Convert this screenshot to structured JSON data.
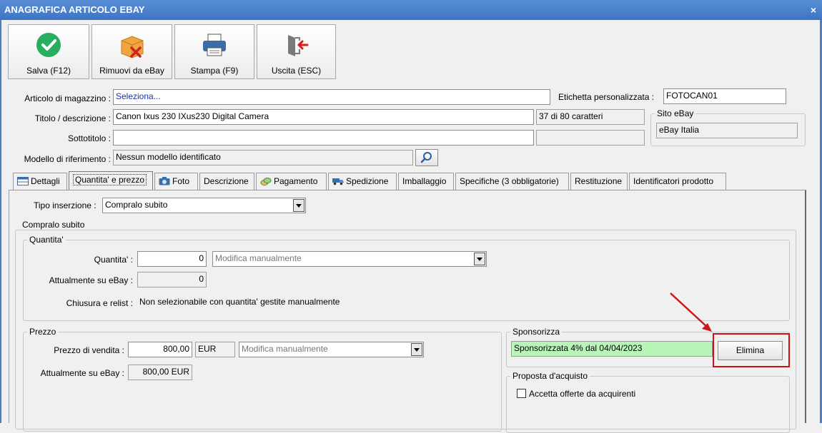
{
  "window": {
    "title": "ANAGRAFICA ARTICOLO EBAY",
    "close": "×"
  },
  "toolbar": {
    "save": "Salva (F12)",
    "remove": "Rimuovi da eBay",
    "print": "Stampa (F9)",
    "exit": "Uscita (ESC)"
  },
  "form": {
    "article_label": "Articolo di magazzino :",
    "article_value": "Seleziona...",
    "custom_label_label": "Etichetta personalizzata :",
    "custom_label_value": "FOTOCAN01",
    "title_label": "Titolo / descrizione :",
    "title_value": "Canon Ixus 230 IXus230 Digital Camera",
    "title_count": "37 di 80 caratteri",
    "subtitle_label": "Sottotitolo :",
    "subtitle_value": "",
    "subtitle_count": "",
    "site_group": "Sito eBay",
    "site_value": "eBay Italia",
    "model_label": "Modello di riferimento :",
    "model_value": "Nessun modello identificato"
  },
  "tabs": [
    "Dettagli",
    "Quantita' e prezzo",
    "Foto",
    "Descrizione",
    "Pagamento",
    "Spedizione",
    "Imballaggio",
    "Specifiche (3 obbligatorie)",
    "Restituzione",
    "Identificatori prodotto"
  ],
  "qty_tab": {
    "insert_type_label": "Tipo inserzione :",
    "insert_type_value": "Compralo subito",
    "buy_now_group": "Compralo subito",
    "quantity_group": "Quantita'",
    "quantity_label": "Quantita' :",
    "quantity_value": "0",
    "quantity_mode": "Modifica manualmente",
    "current_ebay_label": "Attualmente su eBay :",
    "current_ebay_value": "0",
    "close_relist_label": "Chiusura e relist :",
    "close_relist_value": "Non selezionabile con quantita' gestite manualmente",
    "price_group": "Prezzo",
    "price_label": "Prezzo di vendita :",
    "price_value": "800,00",
    "price_currency": "EUR",
    "price_mode": "Modifica manualmente",
    "price_current_label": "Attualmente su eBay :",
    "price_current_value": "800,00 EUR",
    "sponsor_group": "Sponsorizza",
    "sponsor_value": "Sponsorizzata 4% dal 04/04/2023",
    "sponsor_delete": "Elimina",
    "offer_group": "Proposta d'acquisto",
    "offer_checkbox": "Accetta offerte da acquirenti"
  },
  "colors": {
    "titlebar": "#3d74c4",
    "sponsor_bg": "#b9f5b9",
    "highlight": "#d01010"
  }
}
